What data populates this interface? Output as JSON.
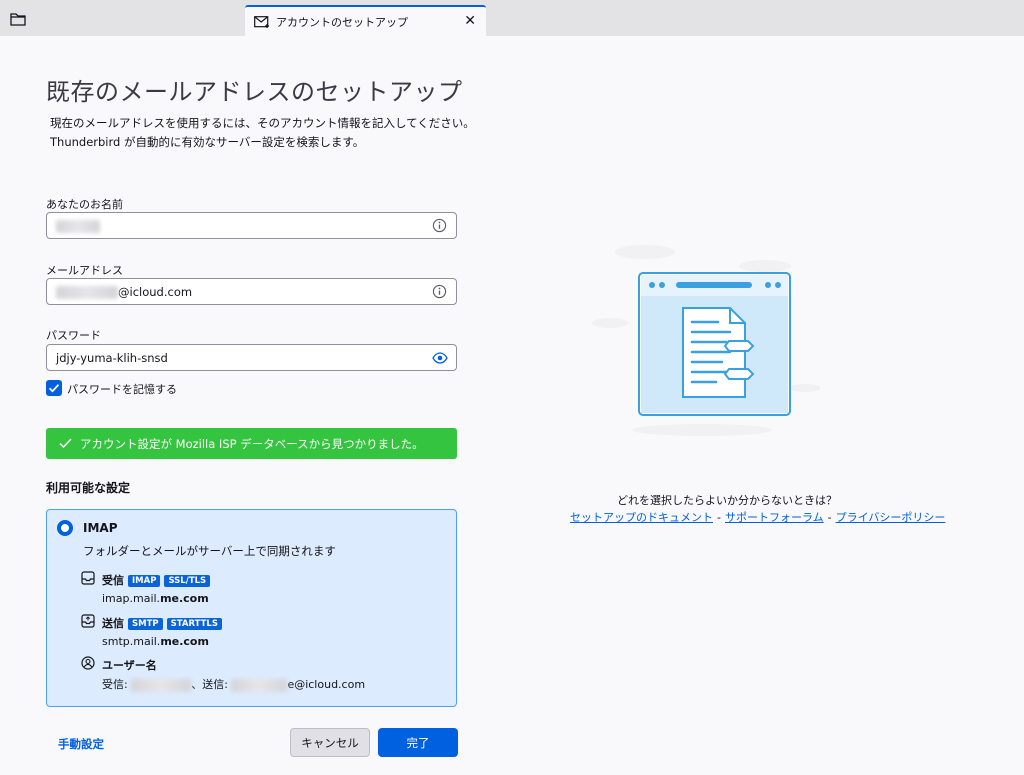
{
  "tab": {
    "title": "アカウントのセットアップ",
    "close": "✕"
  },
  "header": {
    "title": "既存のメールアドレスのセットアップ",
    "desc1": "現在のメールアドレスを使用するには、そのアカウント情報を記入してください。",
    "desc2": "Thunderbird が自動的に有効なサーバー設定を検索します。"
  },
  "form": {
    "name_label": "あなたのお名前",
    "email_label": "メールアドレス",
    "email_suffix": "@icloud.com",
    "password_label": "パスワード",
    "password_value": "jdjy-yuma-klih-snsd",
    "remember_label": "パスワードを記憶する"
  },
  "success_message": "アカウント設定が Mozilla ISP データベースから見つかりました。",
  "config": {
    "section_title": "利用可能な設定",
    "protocol": "IMAP",
    "protocol_desc": "フォルダーとメールがサーバー上で同期されます",
    "incoming_label": "受信",
    "incoming_badges": [
      "IMAP",
      "SSL/TLS"
    ],
    "incoming_host_prefix": "imap.mail.",
    "incoming_host_bold": "me.com",
    "outgoing_label": "送信",
    "outgoing_badges": [
      "SMTP",
      "STARTTLS"
    ],
    "outgoing_host_prefix": "smtp.mail.",
    "outgoing_host_bold": "me.com",
    "username_label": "ユーザー名",
    "username_incoming_prefix": "受信:",
    "username_outgoing_prefix": "、送信:",
    "username_outgoing_suffix": "e@icloud.com"
  },
  "footer": {
    "manual_link": "手動設定",
    "cancel": "キャンセル",
    "done": "完了"
  },
  "help": {
    "question": "どれを選択したらよいか分からないときは？",
    "link_docs": "セットアップのドキュメント",
    "link_forum": "サポートフォーラム",
    "link_privacy": "プライバシーポリシー",
    "separator": "-"
  }
}
